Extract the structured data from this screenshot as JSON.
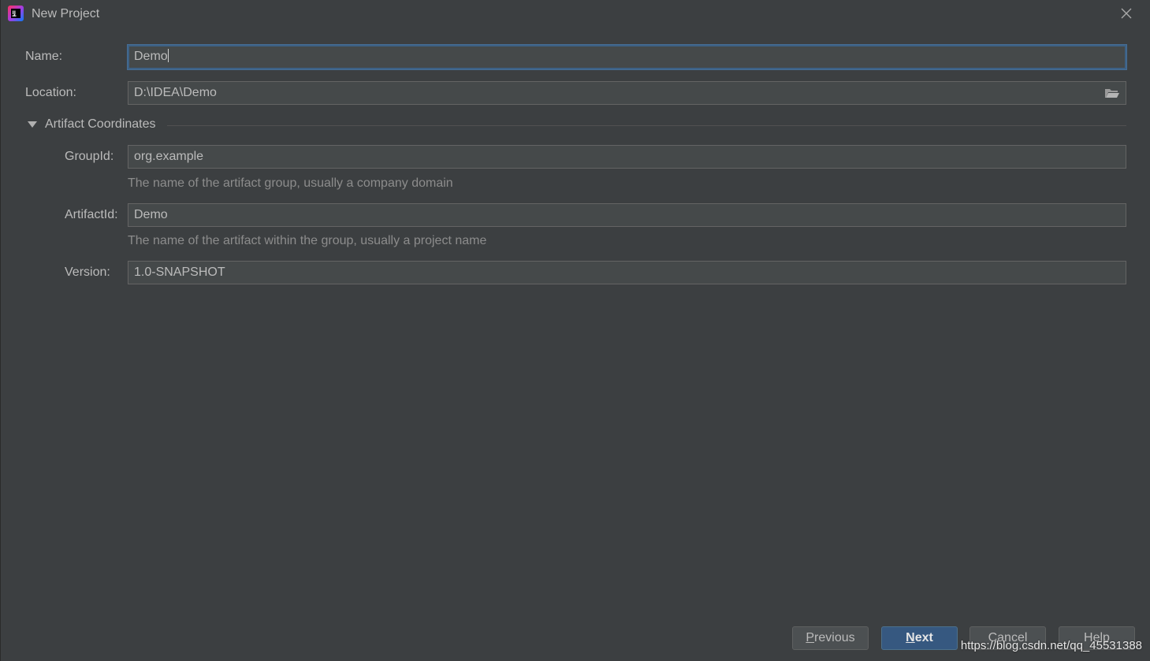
{
  "window": {
    "title": "New Project",
    "app_icon": "intellij-idea-icon",
    "close_icon": "close-icon"
  },
  "form": {
    "name": {
      "label": "Name:",
      "value": "Demo"
    },
    "location": {
      "label": "Location:",
      "value": "D:\\IDEA\\Demo",
      "browse_icon": "folder-icon"
    },
    "artifact_section": {
      "title": "Artifact Coordinates",
      "expanded": true,
      "group_id": {
        "label": "GroupId:",
        "value": "org.example",
        "hint": "The name of the artifact group, usually a company domain"
      },
      "artifact_id": {
        "label": "ArtifactId:",
        "value": "Demo",
        "hint": "The name of the artifact within the group, usually a project name"
      },
      "version": {
        "label": "Version:",
        "value": "1.0-SNAPSHOT"
      }
    }
  },
  "buttons": {
    "previous": {
      "mnemonic": "P",
      "rest": "revious"
    },
    "next": {
      "mnemonic": "N",
      "rest": "ext"
    },
    "cancel": {
      "label": "Cancel"
    },
    "help": {
      "label": "Help"
    }
  },
  "watermark": "https://blog.csdn.net/qq_45531388",
  "colors": {
    "background": "#3c3f41",
    "field_background": "#45494a",
    "focus_border": "#3d6185",
    "primary_button": "#365880",
    "hint_text": "#8c8c8c"
  }
}
